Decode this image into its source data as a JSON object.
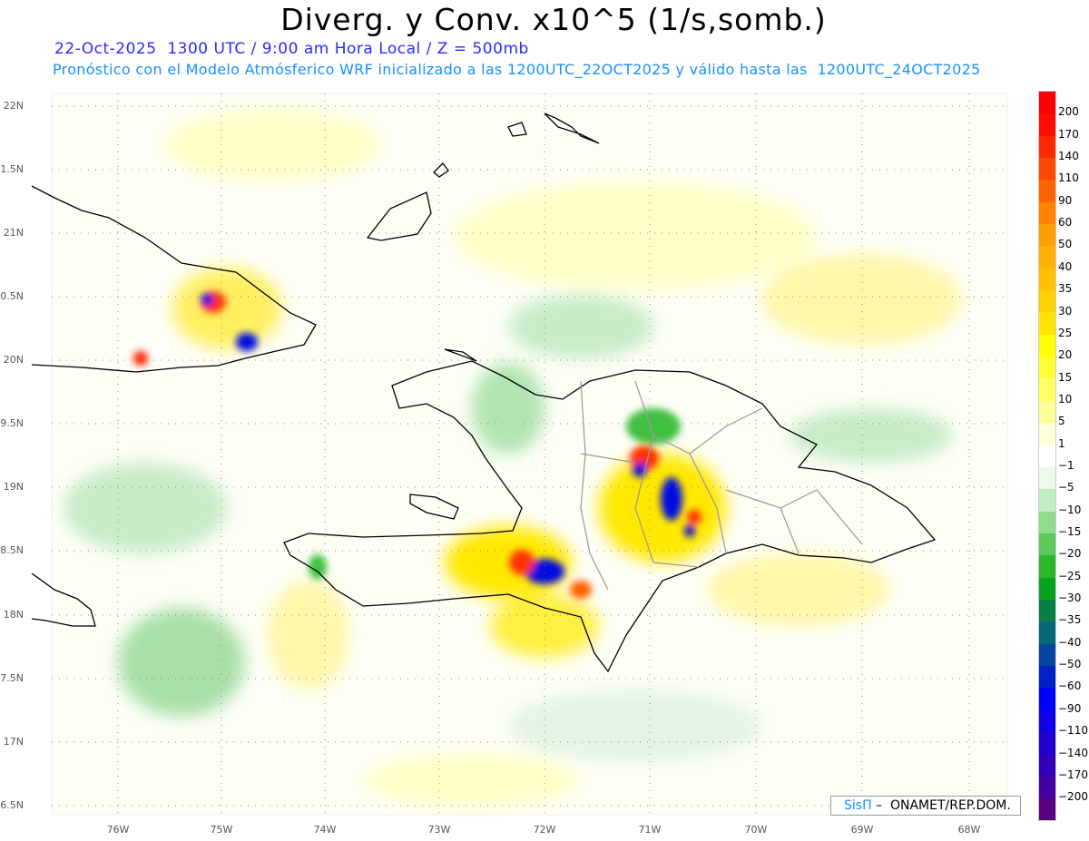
{
  "title": "Diverg. y Conv. x10^5 (1/s,somb.)",
  "subtitle1": "22-Oct-2025  1300 UTC / 9:00 am Hora Local / Z = 500mb",
  "subtitle2": "Pronóstico con el Modelo Atmósferico WRF inicializado a las 1200UTC_22OCT2025 y válido hasta las  1200UTC_24OCT2025",
  "lat_labels": [
    "22N",
    "1.5N",
    "21N",
    "0.5N",
    "20N",
    "9.5N",
    "19N",
    "8.5N",
    "18N",
    "7.5N",
    "17N",
    "6.5N"
  ],
  "lon_labels": [
    "76W",
    "75W",
    "74W",
    "73W",
    "72W",
    "71W",
    "70W",
    "69W",
    "68W"
  ],
  "colorbar": {
    "levels": [
      "200",
      "170",
      "140",
      "110",
      "90",
      "60",
      "50",
      "40",
      "35",
      "30",
      "25",
      "20",
      "15",
      "10",
      "5",
      "1",
      "−1",
      "−5",
      "−10",
      "−15",
      "−20",
      "−25",
      "−30",
      "−35",
      "−40",
      "−50",
      "−60",
      "−90",
      "−110",
      "−140",
      "−170",
      "−200"
    ],
    "colors": [
      "#ff0000",
      "#ff0c00",
      "#ff2a00",
      "#ff4800",
      "#ff6400",
      "#ff8200",
      "#ff9e00",
      "#ffb000",
      "#ffc000",
      "#ffd200",
      "#ffe400",
      "#ffff00",
      "#ffff34",
      "#ffff64",
      "#ffff9a",
      "#ffffd8",
      "#ffffff",
      "#eef8ec",
      "#c2ecc2",
      "#8edc8e",
      "#5cc85c",
      "#2ab82a",
      "#06a41e",
      "#0a8046",
      "#066878",
      "#0446a0",
      "#0020c8",
      "#0000ff",
      "#1000e8",
      "#2000d0",
      "#3000b8",
      "#4400a0",
      "#5a0082"
    ]
  },
  "credit": {
    "brand": "SisΠ",
    "text": " –  ONAMET/REP.DOM."
  }
}
